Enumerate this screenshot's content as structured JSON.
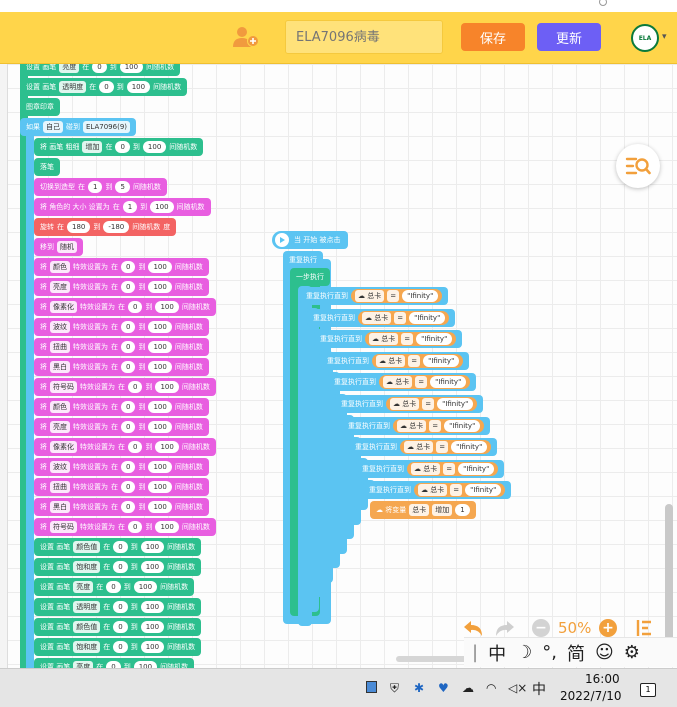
{
  "header": {
    "project_placeholder": "ELA7096病毒",
    "save_label": "保存",
    "update_label": "更新",
    "avatar_text": "ELA"
  },
  "left_stack": {
    "set_color_label": "设置 画笔",
    "prop_brightness": "亮度",
    "prop_transparency": "透明度",
    "prop_color": "颜色值",
    "prop_saturation": "饱和度",
    "in": "在",
    "to": "到",
    "random": "间随机数",
    "v0": "0",
    "v100": "100",
    "v1": "1",
    "v5": "5",
    "v180": "180",
    "vneg180": "-180",
    "stamp": "图章印章",
    "if_label": "如果",
    "self_dd": "自己",
    "touch": "碰到",
    "target": "ELA7096(9)",
    "pen_size": "将 画笔 粗细",
    "increase": "增加",
    "pen_down": "落笔",
    "switch_costume": "切换到造型",
    "size_set": "将 角色的 大小 设置为",
    "turn": "旋转",
    "degrees": "度",
    "move_to": "移到",
    "random_pos": "随机",
    "set_prefix": "将",
    "effect_to": "特效设置为",
    "effects": [
      "颜色",
      "亮度",
      "像素化",
      "波纹",
      "扭曲",
      "黑白",
      "符号码"
    ]
  },
  "right_script": {
    "hat_label": "当 开始 被点击",
    "forever": "重复执行",
    "step": "一步执行",
    "repeat_until": "重复执行直到",
    "var": "总卡",
    "eq": "=",
    "infinity": "Ifinity",
    "change_var": "将变量",
    "increase": "增加",
    "by": "1"
  },
  "zoom": {
    "value": "50%"
  },
  "ime": {
    "mode": "中",
    "moon": "☽",
    "punct": "°,",
    "simplified": "简",
    "emoji": "☺",
    "gear": "⚙"
  },
  "taskbar": {
    "ime_lang": "中",
    "time": "16:00",
    "date": "2022/7/10",
    "notifications": "1"
  },
  "colors": {
    "header": "#ffd54a",
    "save": "#f7842a",
    "update": "#6d5ff5",
    "teal": "#2dbf8e",
    "pink": "#e85ee0",
    "blue": "#5bc4f2",
    "orange": "#f5a750"
  }
}
